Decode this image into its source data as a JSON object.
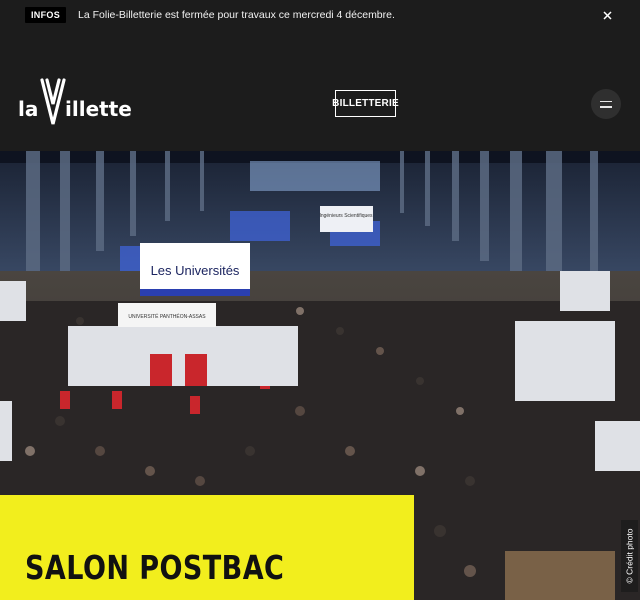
{
  "info_bar": {
    "badge": "INFOS",
    "message": "La Folie-Billetterie est fermée pour travaux ce mercredi 4 décembre.",
    "close_icon": "close-icon"
  },
  "header": {
    "logo_text": "la Villette",
    "billetterie_label": "BILLETTERIE",
    "menu_icon": "hamburger-menu-icon"
  },
  "hero": {
    "title": "SALON POSTBAC",
    "credit": "© Crédit photo",
    "photo_signs": {
      "universites": "Les Universités",
      "pantheon": "UNIVERSITÉ PANTHÉON-ASSAS",
      "ingenieurs": "Ingénieurs Scientifiques"
    }
  },
  "colors": {
    "background": "#1c1c1c",
    "title_box": "#f2ee1d",
    "text": "#ffffff"
  }
}
